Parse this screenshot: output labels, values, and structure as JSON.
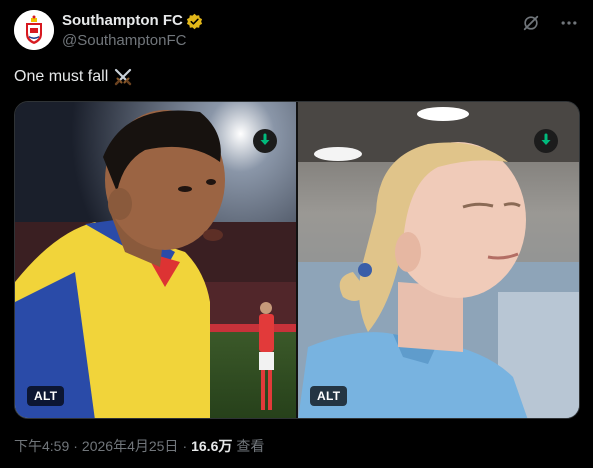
{
  "account": {
    "display_name": "Southampton FC",
    "handle": "@SouthamptonFC"
  },
  "tweet": {
    "text": "One must fall",
    "emoji": "crossed-swords-icon"
  },
  "media": {
    "left": {
      "alt_label": "ALT",
      "download": "download-icon"
    },
    "right": {
      "alt_label": "ALT",
      "download": "download-icon"
    }
  },
  "meta": {
    "time": "下午4:59",
    "date": "2026年4月25日",
    "separator": "·",
    "views_count": "16.6万",
    "views_label": "查看"
  },
  "icons": {
    "grok": "grok-icon",
    "more": "more-icon",
    "verified": "verified-badge-icon"
  },
  "colors": {
    "background": "#000000",
    "text": "#e7e9ea",
    "secondary": "#71767b",
    "download_green": "#00ba7c",
    "verified_gold": "#e2b719"
  }
}
